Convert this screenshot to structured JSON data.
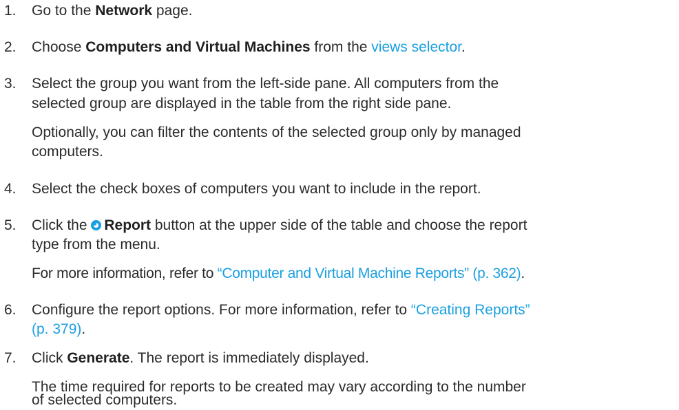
{
  "steps": [
    {
      "num": "1.",
      "pre": "Go to the ",
      "bold": "Network",
      "post": " page."
    },
    {
      "num": "2.",
      "pre": "Choose ",
      "bold": "Computers and Virtual Machines",
      "mid": " from the ",
      "link": "views selector",
      "post": "."
    },
    {
      "num": "3.",
      "line1": "Select the group you want from the left-side pane. All computers from the",
      "line2": "selected group are displayed in the table from the right side pane.",
      "note1": "Optionally, you can filter the contents of the selected group only by managed",
      "note2": "computers."
    },
    {
      "num": "4.",
      "text": "Select the check boxes of computers you want to include in the report."
    },
    {
      "num": "5.",
      "pre": "Click the ",
      "bold": "Report",
      "post": " button at the upper side of the table and choose the report",
      "line2": "type from the menu.",
      "note_pre": "For more information, refer to ",
      "note_link": "“Computer and Virtual Machine Reports” (p. 362)",
      "note_post": "."
    },
    {
      "num": "6.",
      "pre": "Configure the report options. For more information, refer to ",
      "link": "“Creating Reports”",
      "link2": "(p. 379)",
      "post2": "."
    },
    {
      "num": "7.",
      "pre": "Click ",
      "bold": "Generate",
      "post": ". The report is immediately displayed.",
      "note1": "The time required for reports to be created may vary according to the number",
      "note2": "of selected computers."
    }
  ],
  "colors": {
    "link": "#1a9fe0",
    "text": "#2b2b2b"
  },
  "icons": {
    "report": "report-icon"
  }
}
